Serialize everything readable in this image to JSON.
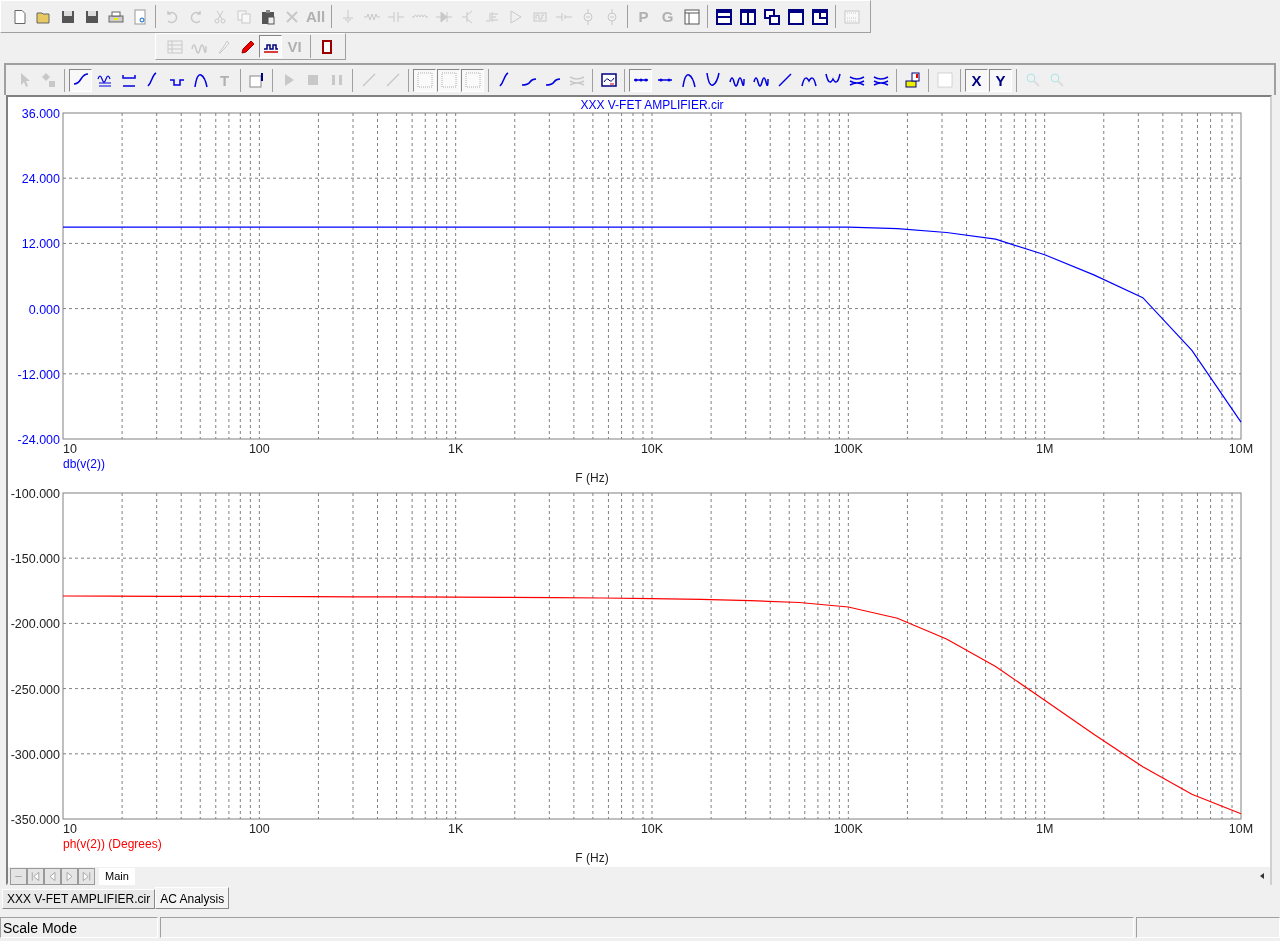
{
  "toolbar_top": {
    "groups": [
      [
        {
          "kind": "new",
          "disabled": false,
          "pressed": false
        },
        {
          "kind": "open",
          "disabled": false,
          "pressed": false
        },
        {
          "kind": "save",
          "disabled": false,
          "pressed": false
        },
        {
          "kind": "save",
          "disabled": false,
          "pressed": false
        },
        {
          "kind": "print",
          "disabled": false,
          "pressed": false
        },
        {
          "kind": "preview",
          "disabled": false,
          "pressed": false
        }
      ],
      [
        {
          "kind": "undo",
          "disabled": true,
          "pressed": false
        },
        {
          "kind": "redo",
          "disabled": true,
          "pressed": false
        },
        {
          "kind": "cut",
          "disabled": true,
          "pressed": false
        },
        {
          "kind": "copy",
          "disabled": true,
          "pressed": false
        },
        {
          "kind": "paste",
          "disabled": false,
          "pressed": false
        },
        {
          "kind": "delete",
          "disabled": true,
          "pressed": false
        },
        {
          "kind": "text",
          "label": "All",
          "disabled": true,
          "pressed": false
        }
      ],
      [
        {
          "kind": "ground",
          "disabled": true,
          "pressed": false
        },
        {
          "kind": "resistor",
          "disabled": true,
          "pressed": false
        },
        {
          "kind": "capacitor",
          "disabled": true,
          "pressed": false
        },
        {
          "kind": "inductor",
          "disabled": true,
          "pressed": false
        },
        {
          "kind": "diode",
          "disabled": true,
          "pressed": false
        },
        {
          "kind": "transistor",
          "disabled": true,
          "pressed": false
        },
        {
          "kind": "mosfet",
          "disabled": true,
          "pressed": false
        },
        {
          "kind": "amplifier",
          "disabled": true,
          "pressed": false
        },
        {
          "kind": "block",
          "disabled": true,
          "pressed": false
        },
        {
          "kind": "battery",
          "disabled": true,
          "pressed": false
        },
        {
          "kind": "source",
          "disabled": true,
          "pressed": false
        },
        {
          "kind": "source",
          "disabled": true,
          "pressed": false
        }
      ],
      [
        {
          "kind": "text",
          "label": "P",
          "disabled": true,
          "pressed": false
        },
        {
          "kind": "text",
          "label": "G",
          "disabled": true,
          "pressed": false
        },
        {
          "kind": "window",
          "disabled": false,
          "pressed": false
        }
      ],
      [
        {
          "kind": "split-h",
          "disabled": false,
          "pressed": false
        },
        {
          "kind": "split-v",
          "disabled": false,
          "pressed": false
        },
        {
          "kind": "cascade",
          "disabled": false,
          "pressed": false
        },
        {
          "kind": "single",
          "disabled": false,
          "pressed": false
        },
        {
          "kind": "corner",
          "disabled": false,
          "pressed": false
        }
      ],
      [
        {
          "kind": "calculator",
          "disabled": true,
          "pressed": false
        }
      ]
    ]
  },
  "toolbar_mid": {
    "groups": [
      [
        {
          "kind": "table",
          "disabled": true,
          "pressed": false
        },
        {
          "kind": "wave",
          "disabled": true,
          "pressed": false
        },
        {
          "kind": "probe",
          "disabled": true,
          "pressed": false
        },
        {
          "kind": "pen",
          "disabled": false,
          "pressed": false
        },
        {
          "kind": "waveform",
          "disabled": false,
          "pressed": true
        },
        {
          "kind": "text",
          "label": "VI",
          "disabled": true,
          "pressed": false
        }
      ],
      [
        {
          "kind": "marker",
          "disabled": false,
          "pressed": false
        }
      ]
    ]
  },
  "toolbar_plot": {
    "groups": [
      [
        {
          "kind": "pointer",
          "disabled": true,
          "pressed": false
        },
        {
          "kind": "shapes",
          "disabled": true,
          "pressed": false
        }
      ],
      [
        {
          "kind": "curve",
          "disabled": false,
          "pressed": true
        },
        {
          "kind": "multiwave",
          "disabled": false,
          "pressed": false
        },
        {
          "kind": "bracket",
          "disabled": false,
          "pressed": false
        },
        {
          "kind": "slope",
          "disabled": false,
          "pressed": false
        },
        {
          "kind": "pulse",
          "disabled": false,
          "pressed": false
        },
        {
          "kind": "peak",
          "disabled": false,
          "pressed": false
        },
        {
          "kind": "text",
          "label": "T",
          "disabled": true,
          "pressed": false
        }
      ],
      [
        {
          "kind": "tag",
          "disabled": false,
          "pressed": false
        }
      ],
      [
        {
          "kind": "play",
          "disabled": true,
          "pressed": false
        },
        {
          "kind": "stop",
          "disabled": true,
          "pressed": false
        },
        {
          "kind": "pause",
          "disabled": true,
          "pressed": false
        }
      ],
      [
        {
          "kind": "line",
          "disabled": true,
          "pressed": false
        },
        {
          "kind": "line",
          "disabled": true,
          "pressed": false
        }
      ],
      [
        {
          "kind": "grid",
          "disabled": false,
          "pressed": true
        },
        {
          "kind": "grid",
          "disabled": false,
          "pressed": true
        },
        {
          "kind": "grid",
          "disabled": false,
          "pressed": true
        }
      ],
      [
        {
          "kind": "slope",
          "disabled": false,
          "pressed": false
        },
        {
          "kind": "rise",
          "disabled": false,
          "pressed": false
        },
        {
          "kind": "rise",
          "disabled": false,
          "pressed": false
        },
        {
          "kind": "bundle",
          "disabled": true,
          "pressed": false
        }
      ],
      [
        {
          "kind": "chart",
          "disabled": false,
          "pressed": false
        }
      ],
      [
        {
          "kind": "dots",
          "disabled": false,
          "pressed": true
        },
        {
          "kind": "linedot",
          "disabled": false,
          "pressed": false
        },
        {
          "kind": "peak",
          "disabled": false,
          "pressed": false
        },
        {
          "kind": "valley",
          "disabled": false,
          "pressed": false
        },
        {
          "kind": "wave",
          "disabled": false,
          "pressed": false
        },
        {
          "kind": "wave",
          "disabled": false,
          "pressed": false
        },
        {
          "kind": "line",
          "disabled": false,
          "pressed": false
        },
        {
          "kind": "peaks",
          "disabled": false,
          "pressed": false
        },
        {
          "kind": "valleys",
          "disabled": false,
          "pressed": false
        },
        {
          "kind": "bundle",
          "disabled": false,
          "pressed": false
        },
        {
          "kind": "bundle",
          "disabled": false,
          "pressed": false
        }
      ],
      [
        {
          "kind": "palette",
          "disabled": false,
          "pressed": false
        }
      ],
      [
        {
          "kind": "blank",
          "disabled": false,
          "pressed": false
        }
      ],
      [
        {
          "kind": "text",
          "label": "X",
          "disabled": false,
          "pressed": true
        },
        {
          "kind": "text",
          "label": "Y",
          "disabled": false,
          "pressed": true
        }
      ],
      [
        {
          "kind": "zoom-in",
          "disabled": true,
          "pressed": false
        },
        {
          "kind": "zoom-out",
          "disabled": true,
          "pressed": false
        }
      ]
    ]
  },
  "plots": [
    {
      "chart_data": {
        "type": "line",
        "grid": true,
        "title": "XXX V-FET AMPLIFIER.cir",
        "xlabel": "F (Hz)",
        "categories": [
          "10",
          null,
          null,
          null,
          "100",
          null,
          null,
          null,
          "1K",
          null,
          null,
          null,
          "10K",
          null,
          null,
          null,
          "100K",
          null,
          null,
          null,
          "1M",
          null,
          null,
          null,
          "10M"
        ],
        "series": [
          {
            "name": "db(v(2))",
            "color": "#0000ff",
            "values": [
              15,
              15,
              15,
              15,
              15,
              15,
              15,
              15,
              15,
              15,
              15,
              15,
              15,
              15,
              15,
              15,
              15,
              14.7,
              14,
              12.8,
              9.9,
              6.2,
              2,
              -7.7,
              -20.9
            ]
          }
        ],
        "ylim": [
          -24,
          36
        ],
        "yticks": [
          {
            "value": -24,
            "label": "-24.000"
          },
          {
            "value": -12,
            "label": "-12.000"
          },
          {
            "value": 0,
            "label": "0.000"
          },
          {
            "value": 12,
            "label": "12.000"
          },
          {
            "value": 24,
            "label": "24.000"
          },
          {
            "value": 36,
            "label": "36.000"
          }
        ]
      }
    },
    {
      "chart_data": {
        "type": "line",
        "grid": true,
        "xlabel": "F (Hz)",
        "categories": [
          "10",
          null,
          null,
          null,
          "100",
          null,
          null,
          null,
          "1K",
          null,
          null,
          null,
          "10K",
          null,
          null,
          null,
          "100K",
          null,
          null,
          null,
          "1M",
          null,
          null,
          null,
          "10M"
        ],
        "series": [
          {
            "name": "ph(v(2)) (Degrees)",
            "color": "#ff0000",
            "values": [
              -179,
              -179.1,
              -179.2,
              -179.3,
              -179.4,
              -179.5,
              -179.6,
              -179.7,
              -179.8,
              -180,
              -180.2,
              -180.5,
              -181,
              -181.5,
              -182.5,
              -184,
              -187.4,
              -196,
              -212,
              -233,
              -259,
              -285,
              -310,
              -331,
              -346
            ]
          }
        ],
        "ylim": [
          -350,
          -100
        ],
        "yticks": [
          {
            "value": -350,
            "label": "-350.000"
          },
          {
            "value": -300,
            "label": "-300.000"
          },
          {
            "value": -250,
            "label": "-250.000"
          },
          {
            "value": -200,
            "label": "-200.000"
          },
          {
            "value": -150,
            "label": "-150.000"
          },
          {
            "value": -100,
            "label": "-100.000"
          }
        ]
      }
    }
  ],
  "page_tabs": [
    {
      "label": "Main",
      "selected": true
    }
  ],
  "document_tabs": [
    {
      "label": "XXX V-FET AMPLIFIER.cir",
      "selected": false
    },
    {
      "label": "AC Analysis",
      "selected": true
    }
  ],
  "status_bar": {
    "mode": "Scale Mode"
  }
}
